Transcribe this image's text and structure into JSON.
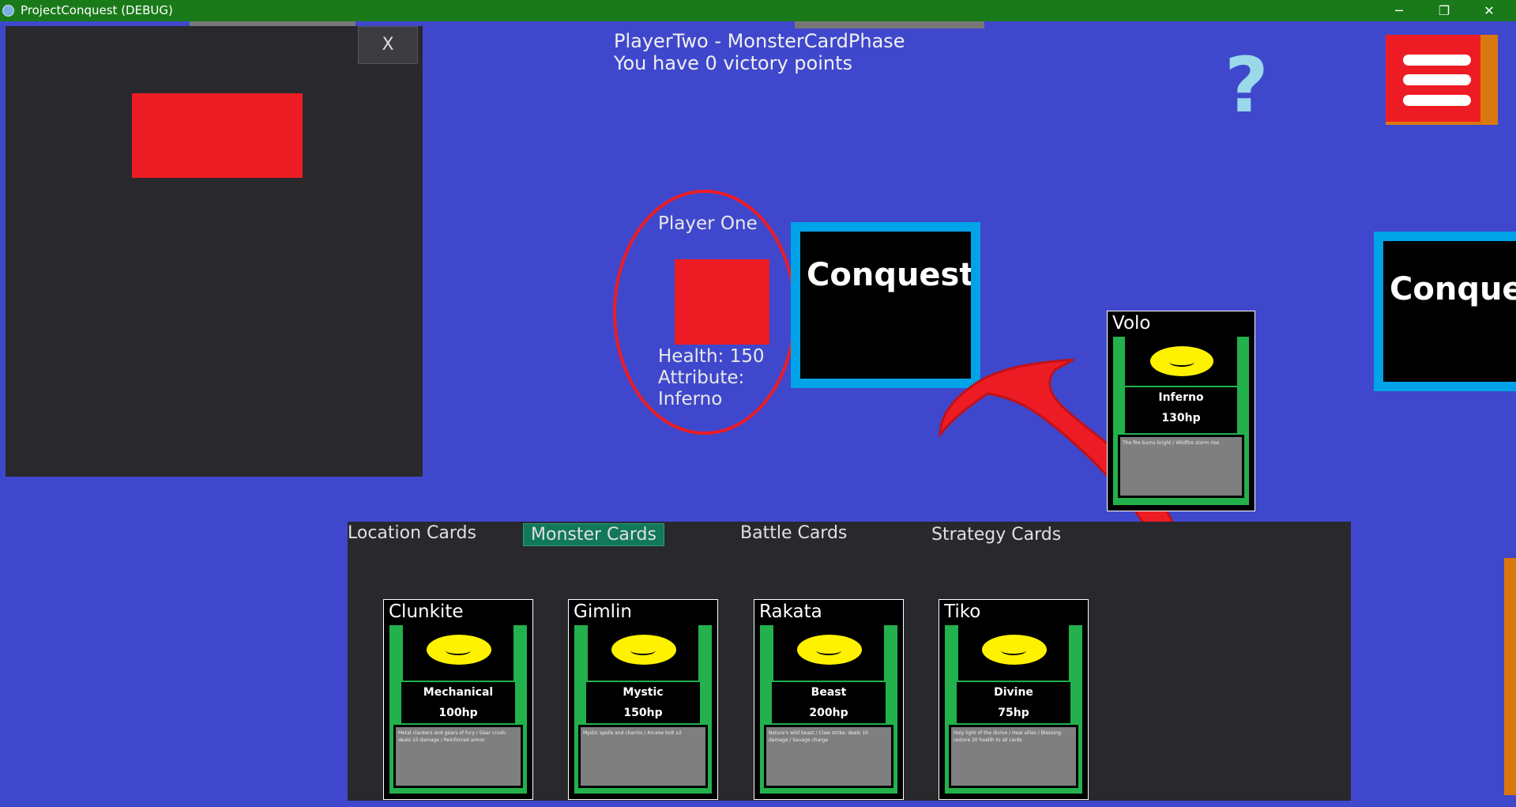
{
  "window": {
    "title": "ProjectConquest (DEBUG)",
    "minimize": "─",
    "restore": "❐",
    "close": "✕"
  },
  "debug_panel": {
    "close_label": "X"
  },
  "status": {
    "line1": "PlayerTwo - MonsterCardPhase",
    "line2": "You have 0 victory points"
  },
  "help": {
    "label": "?"
  },
  "player": {
    "name": "Player One",
    "health": "Health: 150",
    "attribute_label": "Attribute:",
    "attribute": "Inferno"
  },
  "locations": {
    "center_label": "Conquest",
    "right_label": "Conquest"
  },
  "selected_card": {
    "name": "Volo",
    "type": "Inferno",
    "hp": "130hp",
    "desc": "The fire burns bright / Wildfire storm rise"
  },
  "tabs": [
    {
      "label": "Location Cards",
      "active": false
    },
    {
      "label": "Monster Cards",
      "active": true
    },
    {
      "label": "Battle Cards",
      "active": false
    },
    {
      "label": "Strategy Cards",
      "active": false
    }
  ],
  "hand": [
    {
      "name": "Clunkite",
      "type": "Mechanical",
      "hp": "100hp",
      "desc": "Metal clankers and gears of fury / Gear crush: deals 10 damage / Reinforced armor"
    },
    {
      "name": "Gimlin",
      "type": "Mystic",
      "hp": "150hp",
      "desc": "Mystic spells and charms / Arcane bolt x2"
    },
    {
      "name": "Rakata",
      "type": "Beast",
      "hp": "200hp",
      "desc": "Nature's wild beast / Claw strike: deals 10 damage / Savage charge"
    },
    {
      "name": "Tiko",
      "type": "Divine",
      "hp": "75hp",
      "desc": "Holy light of the divine / Heal allies / Blessing: restore 20 health to all cards"
    }
  ],
  "colors": {
    "background": "#3f48cc",
    "accent_red": "#ed1c24",
    "card_green": "#22b14c",
    "location_border": "#00a2e8",
    "active_tab": "#11785a"
  },
  "icons": {
    "app": "godot-icon",
    "help": "question-mark-icon",
    "menu": "hamburger-menu-icon",
    "card_art": "smiley-face-icon"
  }
}
